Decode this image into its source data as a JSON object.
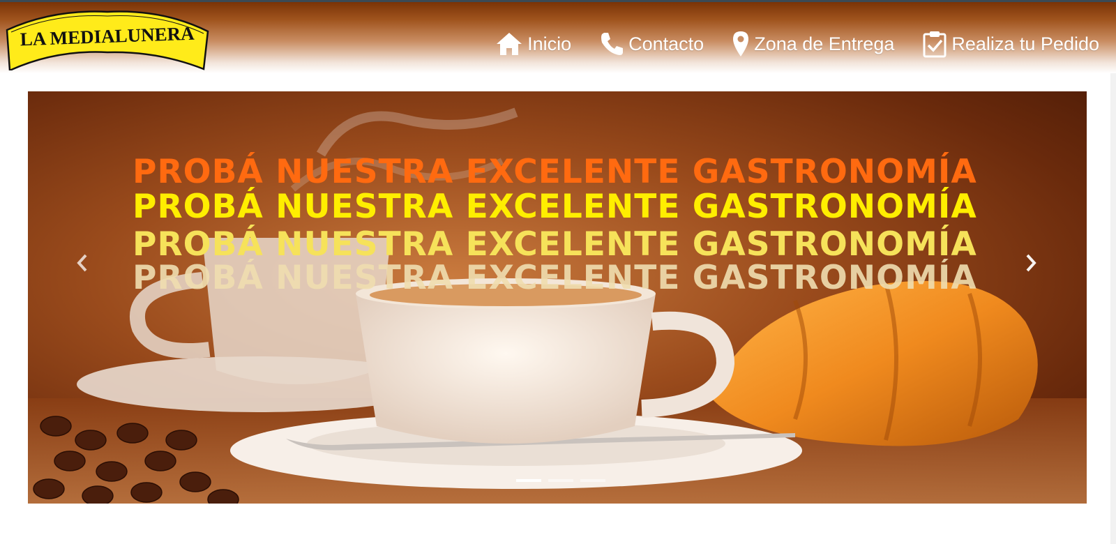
{
  "brand": {
    "name": "LA MEDIALUNERA",
    "colors": {
      "logo_fill": "#ffeb1a",
      "logo_text": "#111111",
      "header_top": "#7a3306"
    }
  },
  "nav": {
    "items": [
      {
        "label": "Inicio",
        "icon": "home-icon"
      },
      {
        "label": "Contacto",
        "icon": "phone-icon"
      },
      {
        "label": "Zona de Entrega",
        "icon": "map-marker-icon"
      },
      {
        "label": "Realiza tu Pedido",
        "icon": "clipboard-check-icon"
      }
    ]
  },
  "carousel": {
    "headlines": [
      "PROBÁ NUESTRA EXCELENTE GASTRONOMÍA",
      "PROBÁ NUESTRA EXCELENTE GASTRONOMÍA",
      "PROBÁ NUESTRA EXCELENTE GASTRONOMÍA",
      "PROBÁ NUESTRA EXCELENTE GASTRONOMÍA"
    ],
    "prev_icon": "chevron-left-icon",
    "next_icon": "chevron-right-icon",
    "slide_count": 3,
    "active_slide": 1
  }
}
